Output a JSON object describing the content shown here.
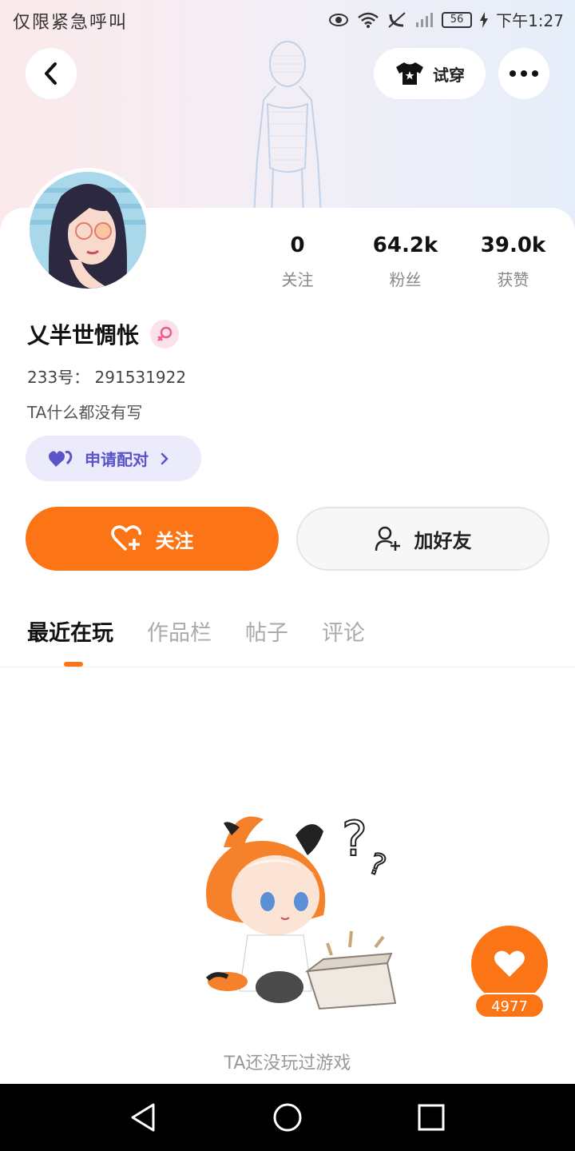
{
  "status_bar": {
    "carrier_text": "仅限紧急呼叫",
    "battery": "56",
    "time": "下午1:27"
  },
  "header": {
    "try_on_label": "试穿"
  },
  "profile": {
    "stats": [
      {
        "value": "0",
        "label": "关注"
      },
      {
        "value": "64.2k",
        "label": "粉丝"
      },
      {
        "value": "39.0k",
        "label": "获赞"
      }
    ],
    "username": "乂半世惆怅",
    "id_text": "233号：  291531922",
    "bio": "TA什么都没有写",
    "pair_label": "申请配对"
  },
  "actions": {
    "follow_label": "关注",
    "add_friend_label": "加好友"
  },
  "tabs": [
    {
      "label": "最近在玩",
      "active": true
    },
    {
      "label": "作品栏",
      "active": false
    },
    {
      "label": "帖子",
      "active": false
    },
    {
      "label": "评论",
      "active": false
    }
  ],
  "empty_state": {
    "message": "TA还没玩过游戏"
  },
  "like_fab": {
    "count": "4977"
  },
  "colors": {
    "accent": "#fb7516",
    "pair_text": "#5b54c9",
    "pair_bg": "#ecebfb"
  }
}
